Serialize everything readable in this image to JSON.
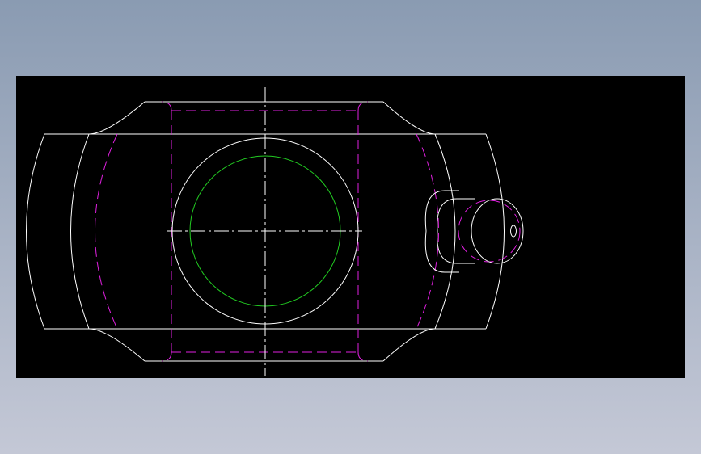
{
  "colors": {
    "background_top": "#8A9BB2",
    "background_bottom": "#C4C8D6",
    "viewport": "#000000",
    "outline": "#FFFFFF",
    "hidden_line": "#E020E0",
    "circle_highlight": "#22CC22",
    "centerline": "#FFFFFF"
  },
  "icons": {
    "drawing": "cad-part-top-view"
  }
}
